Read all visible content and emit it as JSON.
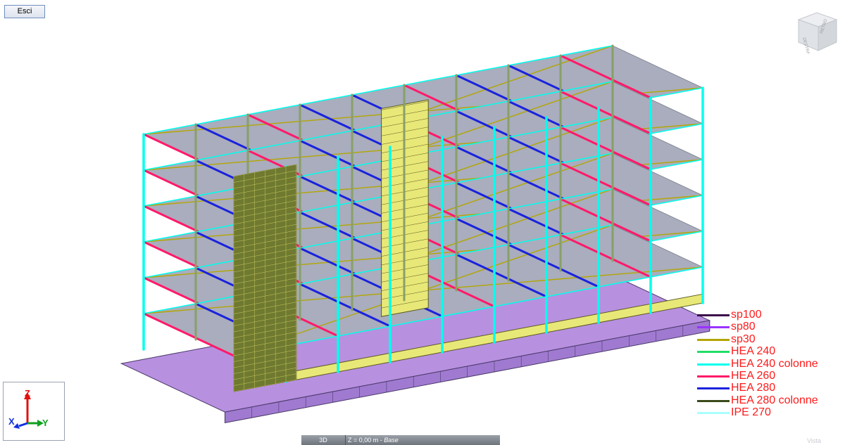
{
  "toolbar": {
    "exit_label": "Esci"
  },
  "legend": {
    "items": [
      {
        "label": "sp100",
        "color": "#3a0a4a"
      },
      {
        "label": "sp80",
        "color": "#9933ff"
      },
      {
        "label": "sp30",
        "color": "#b3a600"
      },
      {
        "label": "HEA 240",
        "color": "#22dd66"
      },
      {
        "label": "HEA 240 colonne",
        "color": "#00ffee"
      },
      {
        "label": "HEA 260",
        "color": "#ff1a6a"
      },
      {
        "label": "HEA 280",
        "color": "#1a22dd"
      },
      {
        "label": "HEA 280 colonne",
        "color": "#3a4a1a"
      },
      {
        "label": "IPE 270",
        "color": "#aaffff"
      }
    ]
  },
  "axes": {
    "z": "Z",
    "x": "X",
    "y": "Y"
  },
  "viewcube": {
    "front": "DESTRA",
    "back": "RETRO"
  },
  "status": {
    "view_mode": "3D",
    "coord_prefix": "Z = 0,00 m - ",
    "coord_level": "Base"
  },
  "corner_mark": "Vista",
  "colors": {
    "slab": "#a9adbd",
    "shell": "#e8e878",
    "mesh": "#5a5a20",
    "foundation": "#b890e0",
    "column": "#00ffee",
    "beam_x": "#1a22dd",
    "beam_y": "#ff1a6a",
    "brace": "#b3a600"
  }
}
